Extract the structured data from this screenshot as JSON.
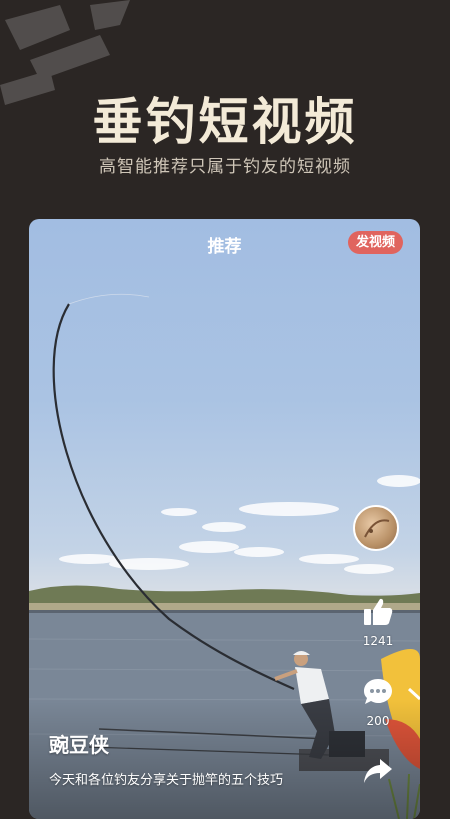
{
  "promo": {
    "title": "垂钓短视频",
    "subtitle": "高智能推荐只属于钓友的短视频"
  },
  "app": {
    "top_title": "推荐",
    "post_button": "发视频"
  },
  "video": {
    "author": "豌豆侠",
    "caption": "今天和各位钓友分享关于抛竿的五个技巧",
    "likes": "1241",
    "comments": "200"
  },
  "colors": {
    "background": "#2b2624",
    "title_text": "#f3ead7",
    "post_button": "#e0645e"
  },
  "icons": [
    "thumbs-up-icon",
    "comment-icon",
    "share-icon"
  ]
}
